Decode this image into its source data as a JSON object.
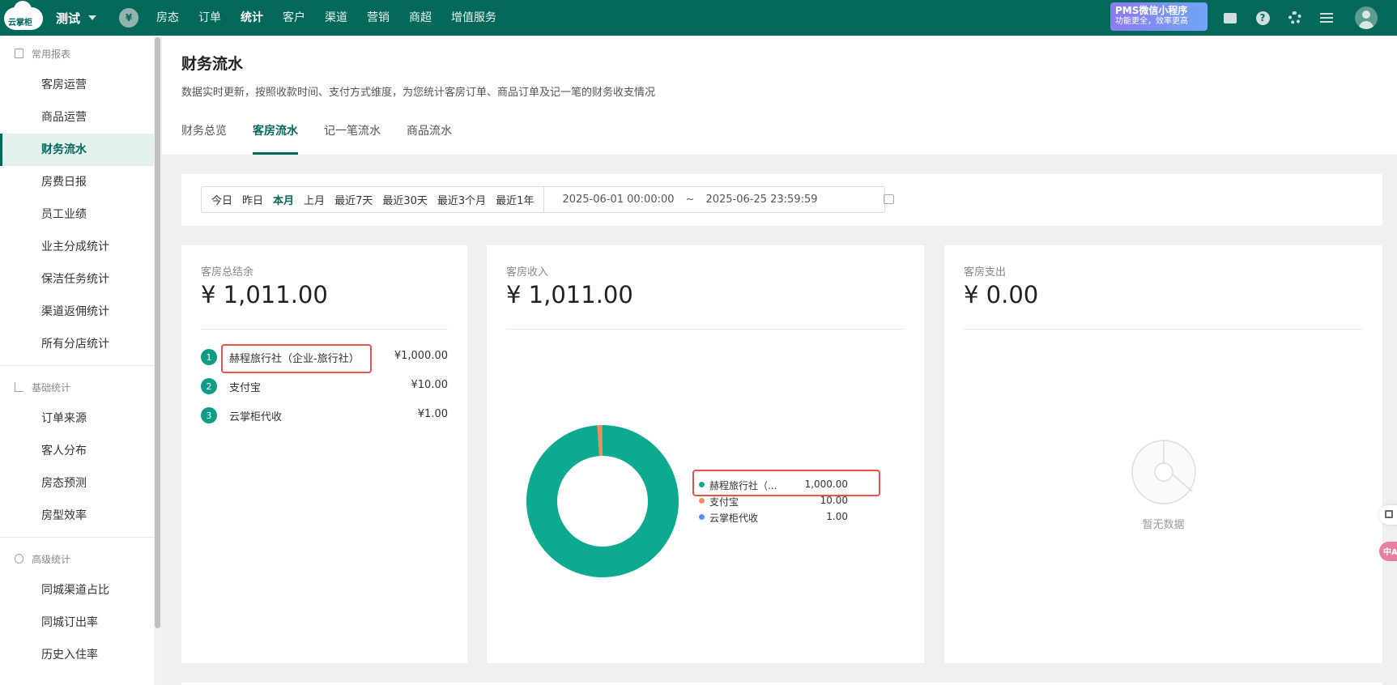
{
  "topbar": {
    "logo_text": "云掌柜",
    "shop_name": "测试",
    "coin_symbol": "¥",
    "nav": [
      "房态",
      "订单",
      "统计",
      "客户",
      "渠道",
      "营销",
      "商超",
      "增值服务"
    ],
    "active_nav": "统计",
    "promo_line1": "PMS微信小程序",
    "promo_line2": "功能更全，效率更高",
    "help_glyph": "?",
    "brand_color": "#04695a"
  },
  "sidebar": {
    "groups": [
      {
        "label": "常用报表",
        "items": [
          "客房运营",
          "商品运营",
          "财务流水",
          "房费日报",
          "员工业绩",
          "业主分成统计",
          "保洁任务统计",
          "渠道返佣统计",
          "所有分店统计"
        ]
      },
      {
        "label": "基础统计",
        "items": [
          "订单来源",
          "客人分布",
          "房态预测",
          "房型效率"
        ]
      },
      {
        "label": "高级统计",
        "items": [
          "同城渠道占比",
          "同城订出率",
          "历史入住率"
        ]
      }
    ],
    "active_item": "财务流水"
  },
  "header": {
    "title": "财务流水",
    "desc": "数据实时更新，按照收款时间、支付方式维度，为您统计客房订单、商品订单及记一笔的财务收支情况",
    "tabs": [
      "财务总览",
      "客房流水",
      "记一笔流水",
      "商品流水"
    ],
    "active_tab": "客房流水"
  },
  "filter": {
    "quick": [
      "今日",
      "昨日",
      "本月",
      "上月",
      "最近7天",
      "最近30天",
      "最近3个月",
      "最近1年"
    ],
    "active_quick": "本月",
    "start": "2025-06-01 00:00:00",
    "tilde": "~",
    "end": "2025-06-25 23:59:59"
  },
  "card_balance": {
    "label": "客房总结余",
    "amount": "¥ 1,011.00",
    "rows": [
      {
        "rank": "1",
        "name": "赫程旅行社（企业-旅行社）",
        "value": "¥1,000.00"
      },
      {
        "rank": "2",
        "name": "支付宝",
        "value": "¥10.00"
      },
      {
        "rank": "3",
        "name": "云掌柜代收",
        "value": "¥1.00"
      }
    ]
  },
  "card_income": {
    "label": "客房收入",
    "amount": "¥ 1,011.00",
    "legend": [
      {
        "name": "赫程旅行社（...",
        "value": "1,000.00",
        "amount": 1000,
        "color": "#0eaa90"
      },
      {
        "name": "支付宝",
        "value": "10.00",
        "amount": 10,
        "color": "#f08d5a"
      },
      {
        "name": "云掌柜代收",
        "value": "1.00",
        "amount": 1,
        "color": "#5b8ff0"
      }
    ]
  },
  "card_expense": {
    "label": "客房支出",
    "amount": "¥ 0.00",
    "empty_text": "暂无数据"
  },
  "float": {
    "translate_label": "中A"
  }
}
